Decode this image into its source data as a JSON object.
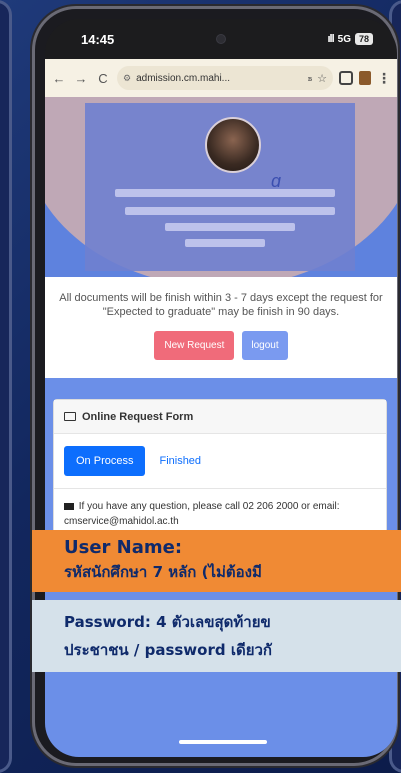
{
  "status_bar": {
    "time": "14:45",
    "signal": "ıll",
    "network": "5G",
    "battery": "78"
  },
  "browser": {
    "back": "←",
    "forward": "→",
    "reload": "C",
    "url": "admission.cm.mahi...",
    "translate": "ᏼ",
    "star": "☆",
    "menu": "⋮"
  },
  "notice": {
    "text": "All documents will be finish within 3 - 7 days except the request for \"Expected to graduate\" may be finish in 90 days.",
    "new_request": "New Request",
    "logout": "logout"
  },
  "card": {
    "title": "Online Request Form",
    "tabs": [
      "On Process",
      "Finished"
    ],
    "contact": "If you have any question, please call 02 206 2000 or email: cmservice@mahidol.ac.th"
  },
  "overlay": {
    "user_line1": "User Name:",
    "user_line2": "รหัสนักศึกษา 7 หลัก (ไม่ต้องมี",
    "pass_line1": "Password: 4 ตัวเลขสุดท้ายข",
    "pass_line2": "ประชาชน / password เดียวกั"
  }
}
